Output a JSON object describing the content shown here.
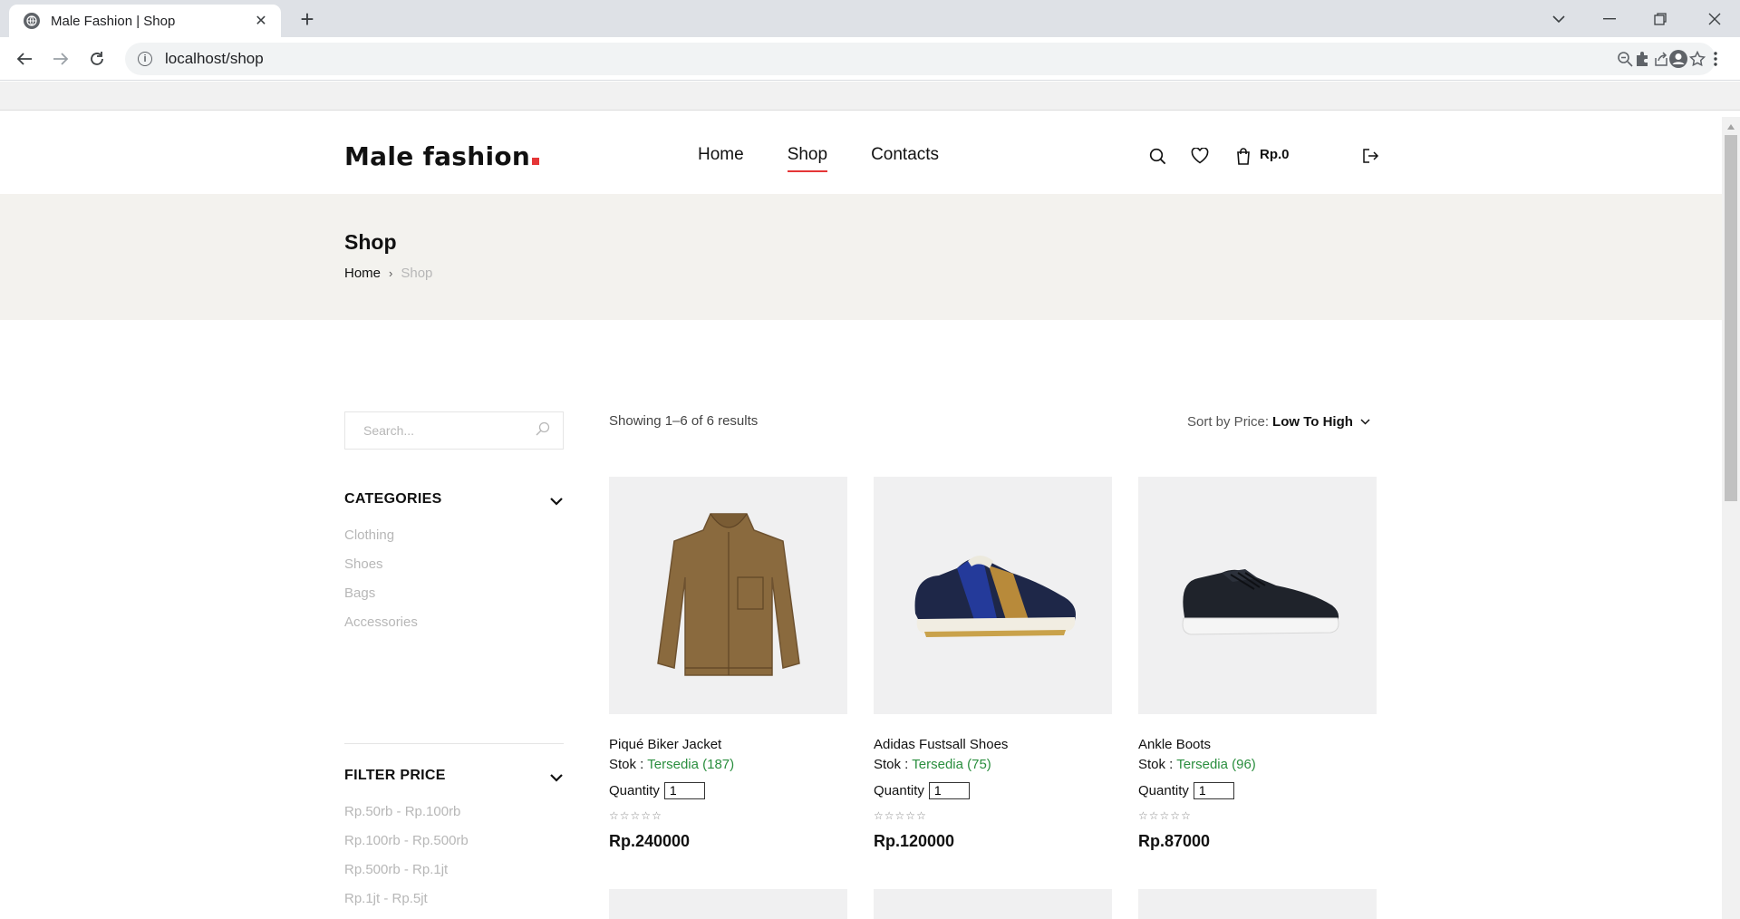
{
  "browser": {
    "tab_title": "Male Fashion | Shop",
    "url": "localhost/shop"
  },
  "header": {
    "logo_text": "Male fashion",
    "nav": [
      "Home",
      "Shop",
      "Contacts"
    ],
    "active_nav": "Shop",
    "cart_total": "Rp.0"
  },
  "breadcrumb": {
    "title": "Shop",
    "home": "Home",
    "current": "Shop"
  },
  "sidebar": {
    "search_placeholder": "Search...",
    "categories_title": "CATEGORIES",
    "categories": [
      "Clothing",
      "Shoes",
      "Bags",
      "Accessories"
    ],
    "price_title": "FILTER PRICE",
    "prices": [
      "Rp.50rb - Rp.100rb",
      "Rp.100rb - Rp.500rb",
      "Rp.500rb - Rp.1jt",
      "Rp.1jt - Rp.5jt"
    ]
  },
  "shop": {
    "result_text": "Showing 1–6 of 6 results",
    "sort_label": "Sort by Price:",
    "sort_value": "Low To High"
  },
  "products": [
    {
      "name": "Piqué Biker Jacket",
      "stock_label": "Stok :",
      "stock_status": "Tersedia (187)",
      "qty_label": "Quantity",
      "qty": "1",
      "price": "Rp.240000",
      "rating": 0
    },
    {
      "name": "Adidas Fustsall Shoes",
      "stock_label": "Stok :",
      "stock_status": "Tersedia (75)",
      "qty_label": "Quantity",
      "qty": "1",
      "price": "Rp.120000",
      "rating": 0
    },
    {
      "name": "Ankle Boots",
      "stock_label": "Stok :",
      "stock_status": "Tersedia (96)",
      "qty_label": "Quantity",
      "qty": "1",
      "price": "Rp.87000",
      "rating": 0
    }
  ],
  "colors": {
    "accent": "#e53637",
    "stock_green": "#2a8e3e",
    "band": "#f3f2ee"
  }
}
